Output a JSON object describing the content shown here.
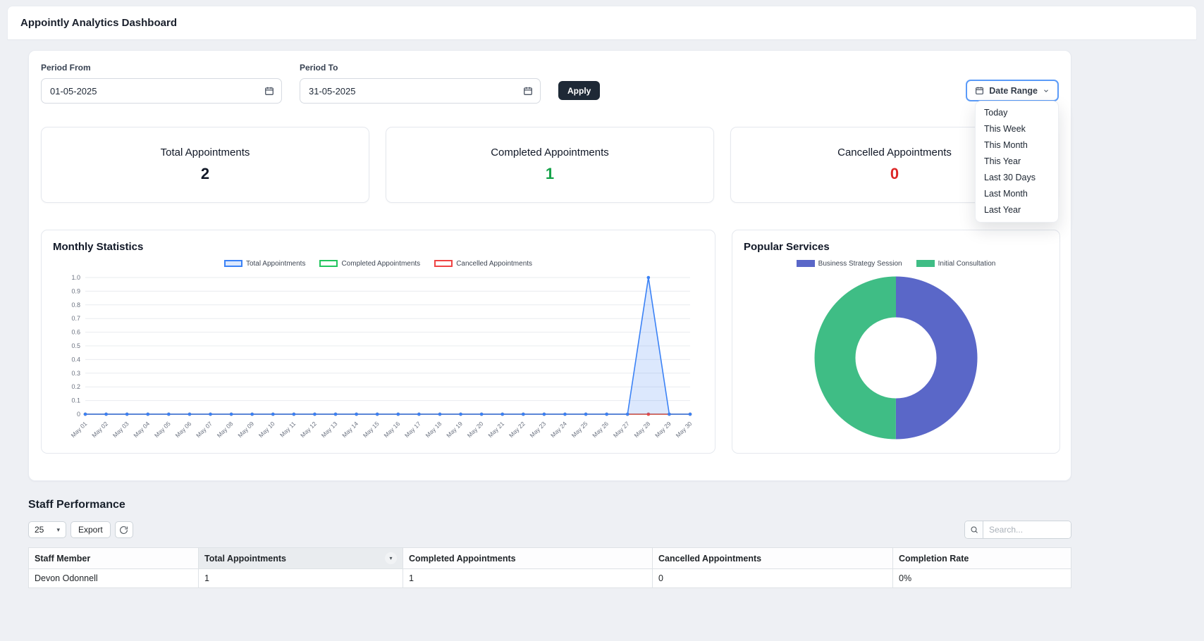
{
  "header": {
    "title": "Appointly Analytics Dashboard"
  },
  "theme": {
    "accent_blue": "#3b82f6",
    "apply_button": "#1e2936",
    "date_range_focus_border": "#5b9bf8",
    "success_green": "#16a34a",
    "danger_red": "#dc2626"
  },
  "icons": {
    "period_from": "calendar-icon",
    "period_to": "calendar-icon",
    "date_range": "calendar-icon",
    "date_range_caret": "chevron-down-icon",
    "search": "search-icon",
    "refresh": "refresh-icon",
    "page_size_caret": "caret-down-icon",
    "column_menu": "chevron-down-icon"
  },
  "filters": {
    "period_from_label": "Period From",
    "period_from_value": "01-05-2025",
    "period_to_label": "Period To",
    "period_to_value": "31-05-2025",
    "apply_label": "Apply",
    "date_range_label": "Date Range",
    "date_range_options": [
      "Today",
      "This Week",
      "This Month",
      "This Year",
      "Last 30 Days",
      "Last Month",
      "Last Year"
    ]
  },
  "stats": [
    {
      "label": "Total Appointments",
      "value": "2",
      "color": "#111827"
    },
    {
      "label": "Completed Appointments",
      "value": "1",
      "color": "#16a34a"
    },
    {
      "label": "Cancelled Appointments",
      "value": "0",
      "color": "#dc2626"
    }
  ],
  "chart_data": [
    {
      "type": "line",
      "title": "Monthly Statistics",
      "x": [
        "May 01",
        "May 02",
        "May 03",
        "May 04",
        "May 05",
        "May 06",
        "May 07",
        "May 08",
        "May 09",
        "May 10",
        "May 11",
        "May 12",
        "May 13",
        "May 14",
        "May 15",
        "May 16",
        "May 17",
        "May 18",
        "May 19",
        "May 20",
        "May 21",
        "May 22",
        "May 23",
        "May 24",
        "May 25",
        "May 26",
        "May 27",
        "May 28",
        "May 29",
        "May 30"
      ],
      "ylim": [
        0,
        1.0
      ],
      "yticks": [
        "0",
        "0.1",
        "0.2",
        "0.3",
        "0.4",
        "0.5",
        "0.6",
        "0.7",
        "0.8",
        "0.9",
        "1.0"
      ],
      "grid": "horizontal",
      "legend_position": "top",
      "series": [
        {
          "name": "Total Appointments",
          "color": "#3b82f6",
          "fill": "rgba(59,130,246,0.18)",
          "values": [
            0,
            0,
            0,
            0,
            0,
            0,
            0,
            0,
            0,
            0,
            0,
            0,
            0,
            0,
            0,
            0,
            0,
            0,
            0,
            0,
            0,
            0,
            0,
            0,
            0,
            0,
            0,
            1,
            0,
            0
          ]
        },
        {
          "name": "Completed Appointments",
          "color": "#22c55e",
          "values": [
            0,
            0,
            0,
            0,
            0,
            0,
            0,
            0,
            0,
            0,
            0,
            0,
            0,
            0,
            0,
            0,
            0,
            0,
            0,
            0,
            0,
            0,
            0,
            0,
            0,
            0,
            0,
            0,
            0,
            0
          ]
        },
        {
          "name": "Cancelled Appointments",
          "color": "#ef4444",
          "values": [
            0,
            0,
            0,
            0,
            0,
            0,
            0,
            0,
            0,
            0,
            0,
            0,
            0,
            0,
            0,
            0,
            0,
            0,
            0,
            0,
            0,
            0,
            0,
            0,
            0,
            0,
            0,
            0,
            0,
            0
          ]
        }
      ]
    },
    {
      "type": "pie",
      "donut": true,
      "title": "Popular Services",
      "legend_position": "top",
      "labels": [
        "Business Strategy Session",
        "Initial Consultation"
      ],
      "values": [
        1,
        1
      ],
      "colors": [
        "#5a67c8",
        "#3fbd85"
      ]
    }
  ],
  "staff": {
    "title": "Staff Performance",
    "page_size": "25",
    "export_label": "Export",
    "search_placeholder": "Search...",
    "columns": [
      "Staff Member",
      "Total Appointments",
      "Completed Appointments",
      "Cancelled Appointments",
      "Completion Rate"
    ],
    "rows": [
      [
        "Devon Odonnell",
        "1",
        "1",
        "0",
        "0%"
      ]
    ]
  }
}
